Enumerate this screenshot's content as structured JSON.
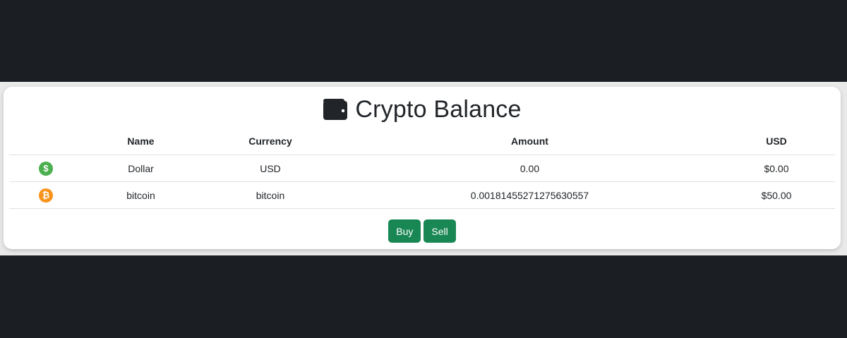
{
  "page": {
    "title": "Crypto Balance",
    "title_icon": "wallet-icon"
  },
  "table": {
    "headers": {
      "icon": "",
      "name": "Name",
      "currency": "Currency",
      "amount": "Amount",
      "usd": "USD"
    },
    "rows": [
      {
        "icon": "dollar-coin-icon",
        "icon_glyph": "$",
        "icon_color": "#4caf50",
        "name": "Dollar",
        "currency": "USD",
        "amount": "0.00",
        "usd": "$0.00"
      },
      {
        "icon": "bitcoin-coin-icon",
        "icon_glyph": "₿",
        "icon_color": "#f7931a",
        "name": "bitcoin",
        "currency": "bitcoin",
        "amount": "0.00181455271275630557",
        "usd": "$50.00"
      }
    ]
  },
  "actions": {
    "buy_label": "Buy",
    "sell_label": "Sell",
    "button_color": "#198754"
  },
  "colors": {
    "background": "#1b1e23",
    "card": "#ffffff",
    "text": "#212529"
  }
}
